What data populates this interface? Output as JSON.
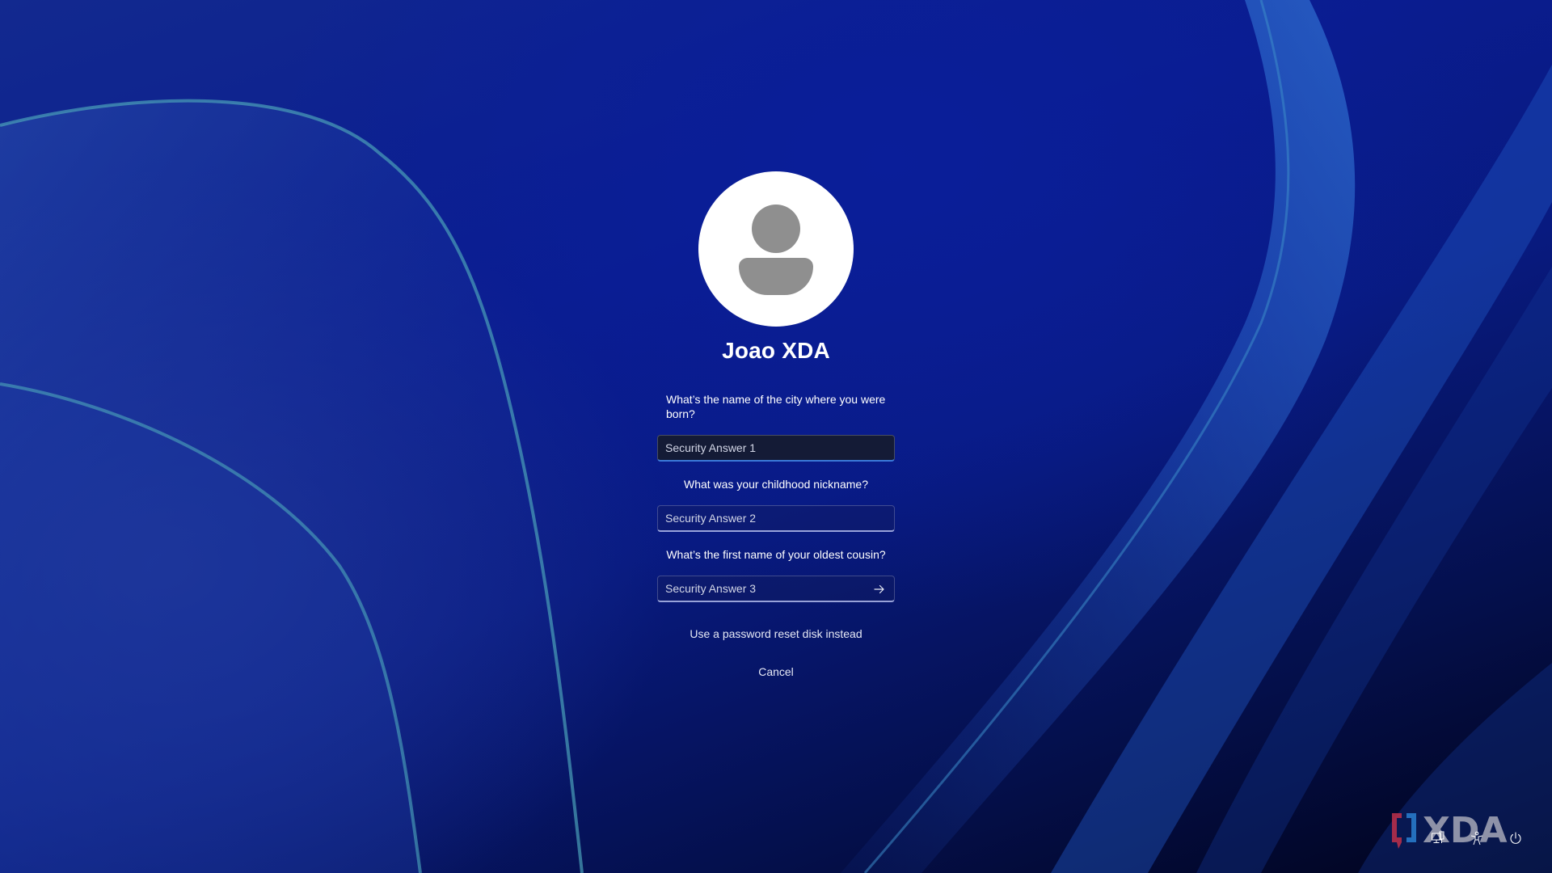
{
  "user": {
    "display_name": "Joao XDA"
  },
  "security_questions": [
    {
      "question": "What’s the name of the city where you were born?",
      "placeholder": "Security Answer 1",
      "value": ""
    },
    {
      "question": "What was your childhood nickname?",
      "placeholder": "Security Answer 2",
      "value": ""
    },
    {
      "question": "What’s the first name of your oldest cousin?",
      "placeholder": "Security Answer 3",
      "value": ""
    }
  ],
  "actions": {
    "submit_icon": "arrow-right-icon",
    "reset_disk_label": "Use a password reset disk instead",
    "cancel_label": "Cancel"
  },
  "system_tray": {
    "icons": [
      "network-icon",
      "accessibility-icon",
      "power-icon"
    ]
  },
  "watermark": {
    "text": "XDA"
  },
  "colors": {
    "background_primary": "#0a1c8f",
    "background_dark": "#01031a",
    "text": "#ffffff",
    "avatar_bg": "#ffffff",
    "avatar_glyph": "#8f8f8f",
    "focus_accent": "#3a78d8",
    "watermark_red": "#c0304a",
    "watermark_blue": "#2a7fd0",
    "watermark_gray": "#a6a8b8"
  }
}
